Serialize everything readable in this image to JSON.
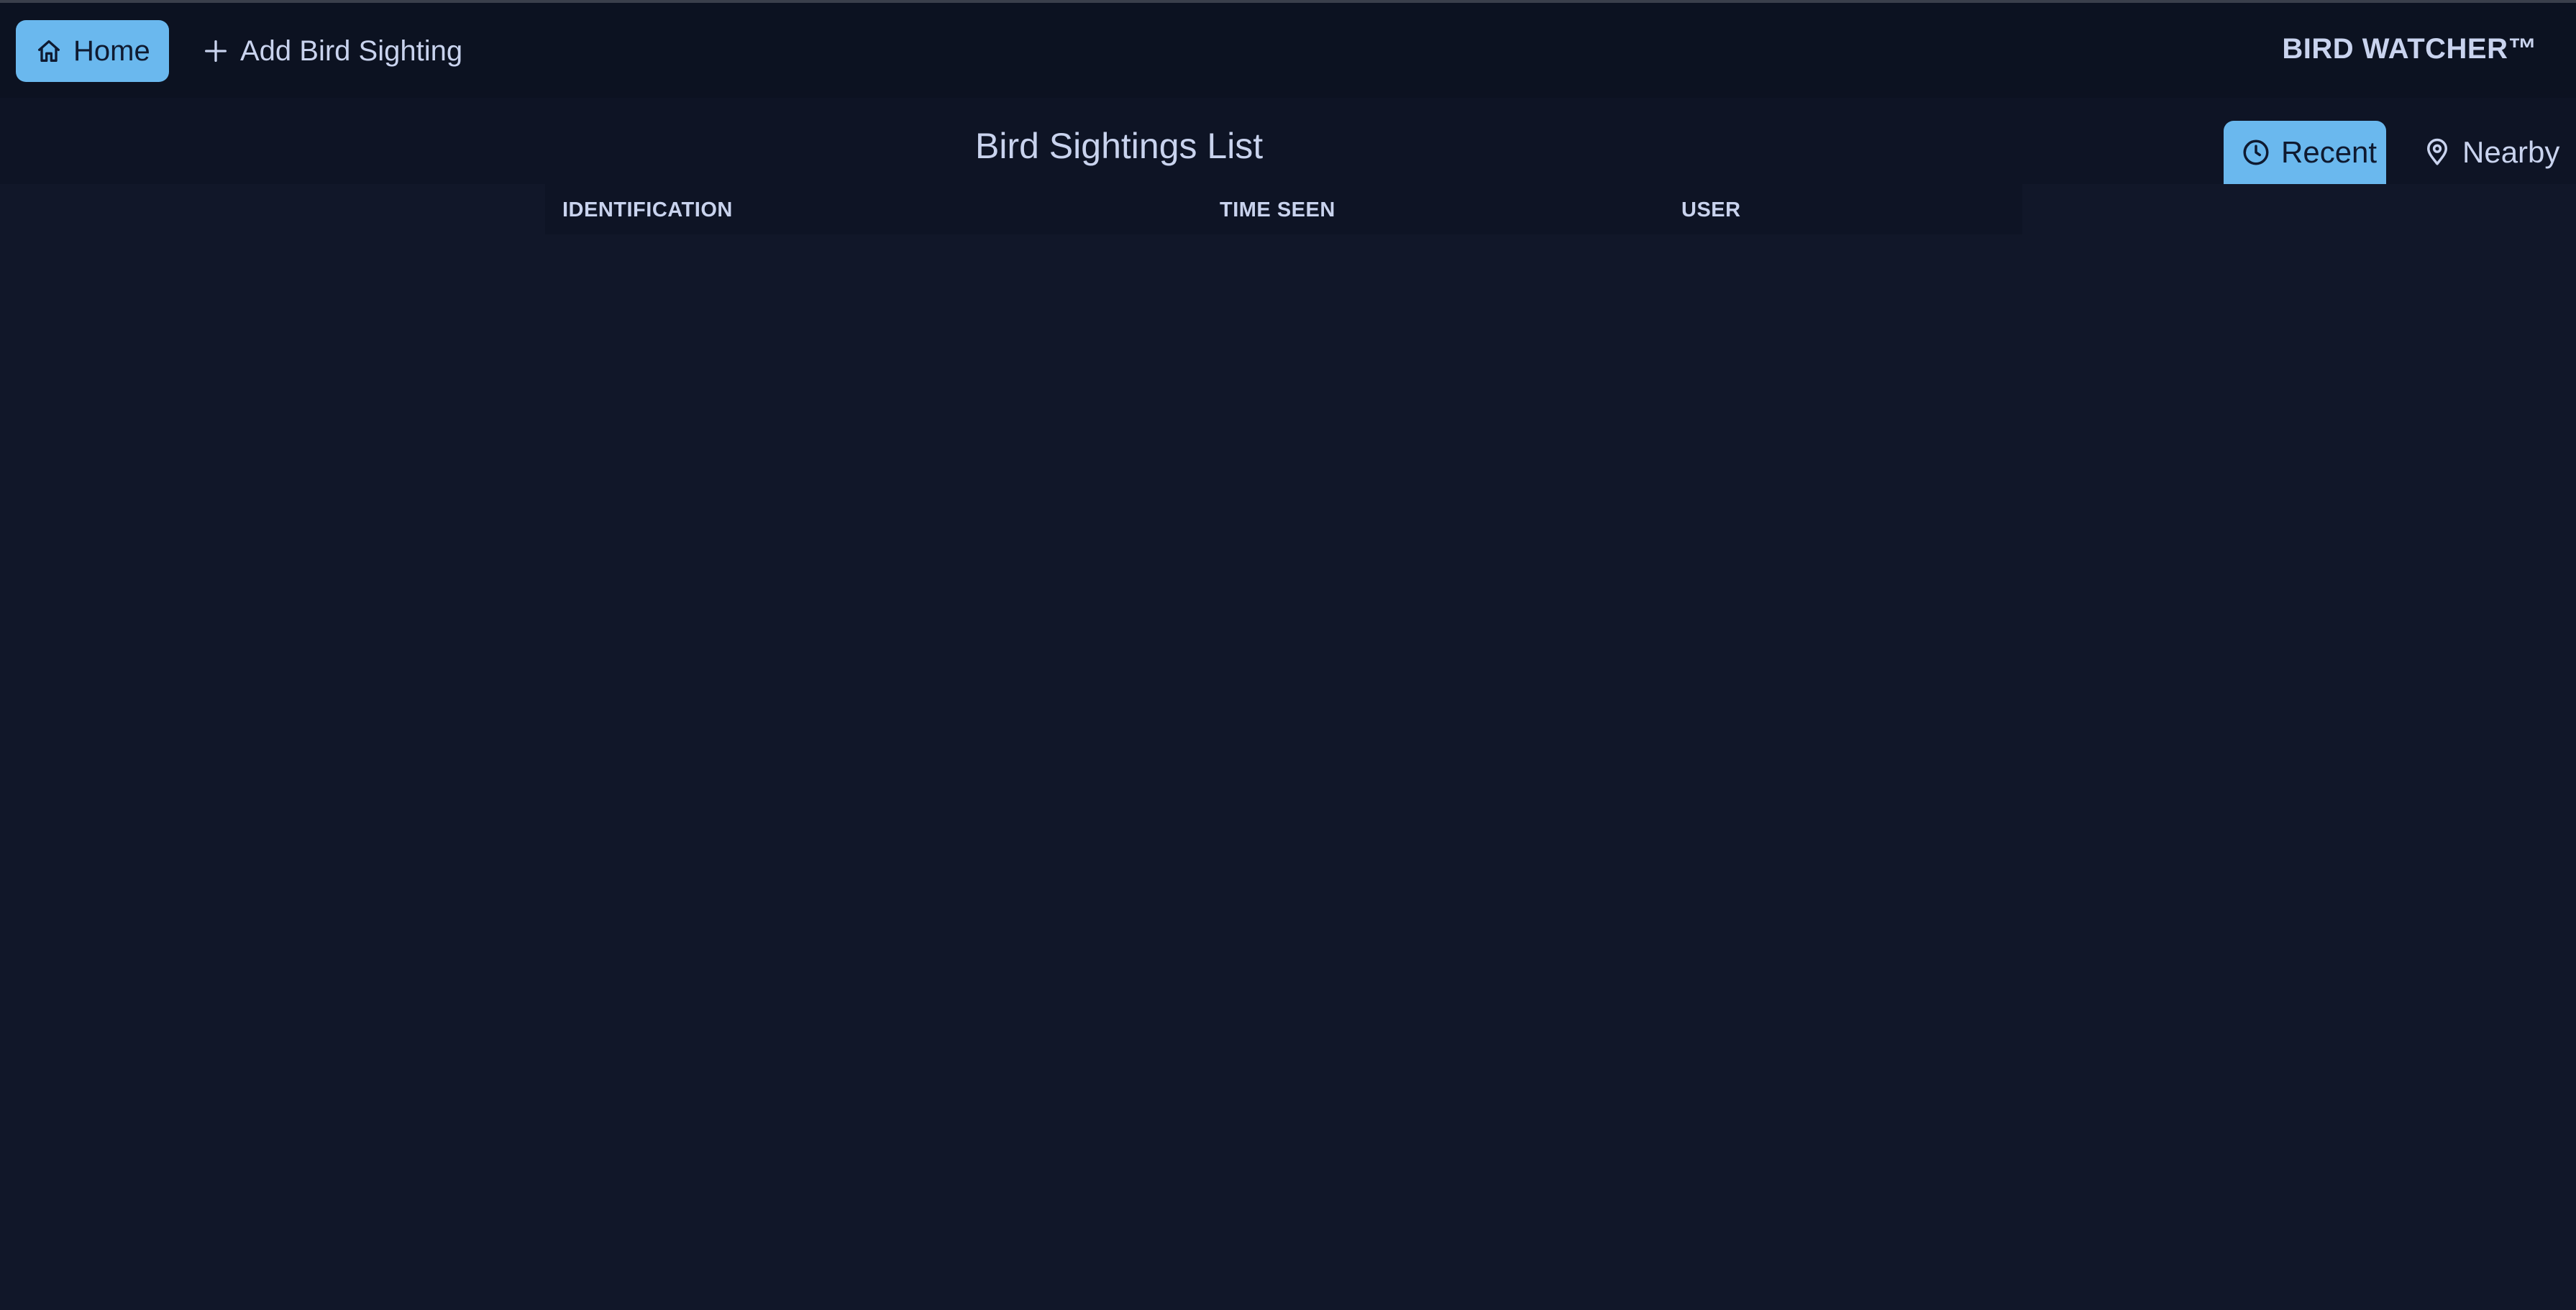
{
  "nav": {
    "home_label": "Home",
    "add_label": "Add Bird Sighting",
    "brand": "BIRD WATCHER™"
  },
  "main": {
    "title": "Bird Sightings List",
    "tabs": [
      {
        "label": "Recent",
        "icon": "clock-icon",
        "active": true
      },
      {
        "label": "Nearby",
        "icon": "map-pin-icon",
        "active": false
      }
    ]
  },
  "table": {
    "columns": [
      "IDENTIFICATION",
      "TIME SEEN",
      "USER"
    ],
    "rows": []
  },
  "colors": {
    "background": "#111729",
    "topbar": "#0c1221",
    "accent": "#6ab8ee",
    "text": "#c9d3ee"
  }
}
